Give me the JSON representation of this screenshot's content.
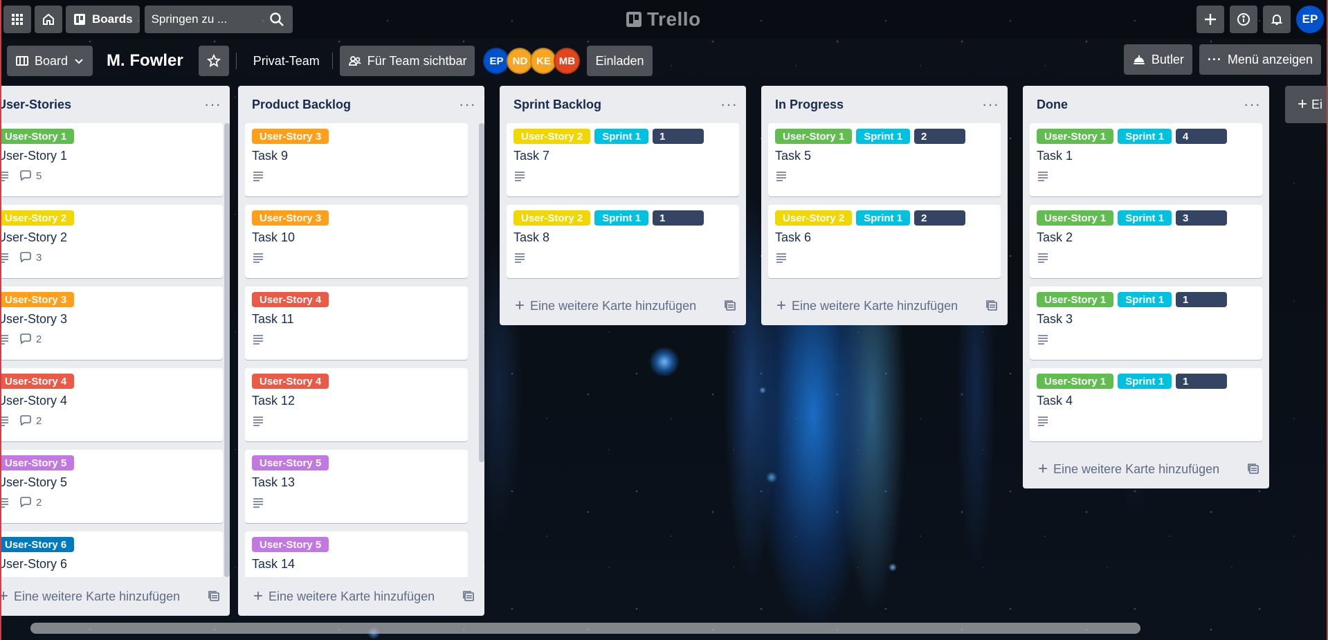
{
  "topnav": {
    "boards_label": "Boards",
    "search_placeholder": "Springen zu ...",
    "logo_text": "Trello",
    "user_initials": "EP"
  },
  "board": {
    "view_label": "Board",
    "title": "M. Fowler",
    "team": "Privat-Team",
    "visibility": "Für Team sichtbar",
    "invite_label": "Einladen",
    "butler_label": "Butler",
    "menu_label": "Menü anzeigen",
    "members": [
      {
        "initials": "EP",
        "color": "#0052cc"
      },
      {
        "initials": "ND",
        "color": "#f6a623"
      },
      {
        "initials": "KE",
        "color": "#f6a623"
      },
      {
        "initials": "MB",
        "color": "#e2461e"
      }
    ]
  },
  "add_card_label": "Eine weitere Karte hinzufügen",
  "add_list_label": "Ei",
  "label_colors": {
    "green": "#61bd4f",
    "yellow": "#f2d600",
    "orange": "#ff9f1a",
    "red": "#eb5a46",
    "purple": "#c377e0",
    "blue": "#0079bf",
    "sky": "#00c2e0",
    "black": "#344563"
  },
  "lists": [
    {
      "title": "User-Stories",
      "cards": [
        {
          "title": "User-Story 1",
          "labels": [
            {
              "text": "User-Story 1",
              "color": "green"
            }
          ],
          "comments": "5"
        },
        {
          "title": "User-Story 2",
          "labels": [
            {
              "text": "User-Story 2",
              "color": "yellow"
            }
          ],
          "comments": "3"
        },
        {
          "title": "User-Story 3",
          "labels": [
            {
              "text": "User-Story 3",
              "color": "orange"
            }
          ],
          "comments": "2"
        },
        {
          "title": "User-Story 4",
          "labels": [
            {
              "text": "User-Story 4",
              "color": "red"
            }
          ],
          "comments": "2"
        },
        {
          "title": "User-Story 5",
          "labels": [
            {
              "text": "User-Story 5",
              "color": "purple"
            }
          ],
          "comments": "2"
        },
        {
          "title": "User-Story 6",
          "labels": [
            {
              "text": "User-Story 6",
              "color": "blue"
            }
          ]
        }
      ]
    },
    {
      "title": "Product Backlog",
      "cards": [
        {
          "title": "Task 9",
          "labels": [
            {
              "text": "User-Story 3",
              "color": "orange"
            }
          ]
        },
        {
          "title": "Task 10",
          "labels": [
            {
              "text": "User-Story 3",
              "color": "orange"
            }
          ]
        },
        {
          "title": "Task 11",
          "labels": [
            {
              "text": "User-Story 4",
              "color": "red"
            }
          ]
        },
        {
          "title": "Task 12",
          "labels": [
            {
              "text": "User-Story 4",
              "color": "red"
            }
          ]
        },
        {
          "title": "Task 13",
          "labels": [
            {
              "text": "User-Story 5",
              "color": "purple"
            }
          ]
        },
        {
          "title": "Task 14",
          "labels": [
            {
              "text": "User-Story 5",
              "color": "purple"
            }
          ]
        }
      ]
    },
    {
      "title": "Sprint Backlog",
      "cards": [
        {
          "title": "Task 7",
          "labels": [
            {
              "text": "User-Story 2",
              "color": "yellow"
            },
            {
              "text": "Sprint 1",
              "color": "sky"
            },
            {
              "text": "1",
              "color": "black"
            }
          ]
        },
        {
          "title": "Task 8",
          "labels": [
            {
              "text": "User-Story 2",
              "color": "yellow"
            },
            {
              "text": "Sprint 1",
              "color": "sky"
            },
            {
              "text": "1",
              "color": "black"
            }
          ]
        }
      ]
    },
    {
      "title": "In Progress",
      "cards": [
        {
          "title": "Task 5",
          "labels": [
            {
              "text": "User-Story 1",
              "color": "green"
            },
            {
              "text": "Sprint 1",
              "color": "sky"
            },
            {
              "text": "2",
              "color": "black"
            }
          ]
        },
        {
          "title": "Task 6",
          "labels": [
            {
              "text": "User-Story 2",
              "color": "yellow"
            },
            {
              "text": "Sprint 1",
              "color": "sky"
            },
            {
              "text": "2",
              "color": "black"
            }
          ]
        }
      ]
    },
    {
      "title": "Done",
      "cards": [
        {
          "title": "Task 1",
          "labels": [
            {
              "text": "User-Story 1",
              "color": "green"
            },
            {
              "text": "Sprint 1",
              "color": "sky"
            },
            {
              "text": "4",
              "color": "black"
            }
          ]
        },
        {
          "title": "Task 2",
          "labels": [
            {
              "text": "User-Story 1",
              "color": "green"
            },
            {
              "text": "Sprint 1",
              "color": "sky"
            },
            {
              "text": "3",
              "color": "black"
            }
          ]
        },
        {
          "title": "Task 3",
          "labels": [
            {
              "text": "User-Story 1",
              "color": "green"
            },
            {
              "text": "Sprint 1",
              "color": "sky"
            },
            {
              "text": "1",
              "color": "black"
            }
          ]
        },
        {
          "title": "Task 4",
          "labels": [
            {
              "text": "User-Story 1",
              "color": "green"
            },
            {
              "text": "Sprint 1",
              "color": "sky"
            },
            {
              "text": "1",
              "color": "black"
            }
          ]
        }
      ]
    }
  ]
}
